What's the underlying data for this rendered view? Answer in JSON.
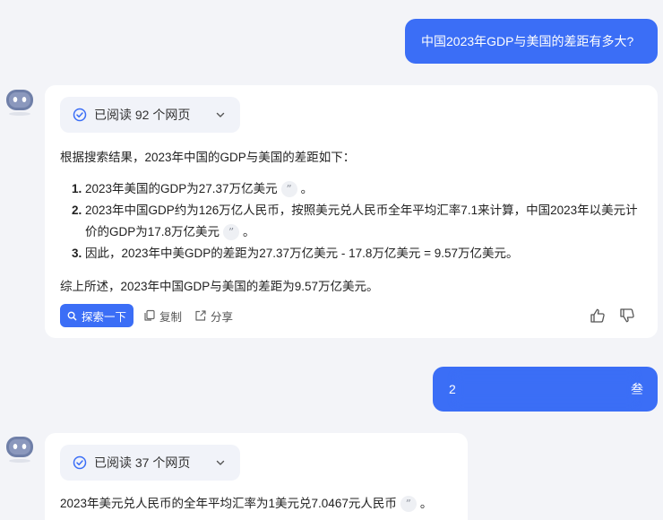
{
  "conversation": {
    "q1": "中国2023年GDP与美国的差距有多大?",
    "a1": {
      "read_label": "已阅读 92 个网页",
      "intro": "根据搜索结果，2023年中国的GDP与美国的差距如下：",
      "points": [
        "2023年美国的GDP为27.37万亿美元",
        "2023年中国GDP约为126万亿人民币，按照美元兑人民币全年平均汇率7.1来计算，中国2023年以美元计价的GDP为17.8万亿美元",
        "因此，2023年中美GDP的差距为27.37万亿美元 - 17.8万亿美元 = 9.57万亿美元。"
      ],
      "summary": "综上所述，2023年中国GDP与美国的差距为9.57万亿美元。",
      "actions": {
        "explore": "探索一下",
        "copy": "复制",
        "share": "分享"
      }
    },
    "q2_visible_start": "2",
    "q2_visible_end": "叁",
    "a2": {
      "read_label": "已阅读 37 个网页",
      "text": "2023年美元兑人民币的全年平均汇率为1美元兑7.0467元人民币"
    }
  },
  "punctuation": {
    "period": "。",
    "quote_glyph": "”"
  },
  "colors": {
    "accent": "#3b6ef6",
    "bg": "#f3f4f8"
  },
  "icons": [
    "bot-avatar-icon",
    "check-circle-icon",
    "chevron-down-icon",
    "search-icon",
    "copy-icon",
    "share-icon",
    "thumbs-up-icon",
    "thumbs-down-icon",
    "quote-icon"
  ]
}
